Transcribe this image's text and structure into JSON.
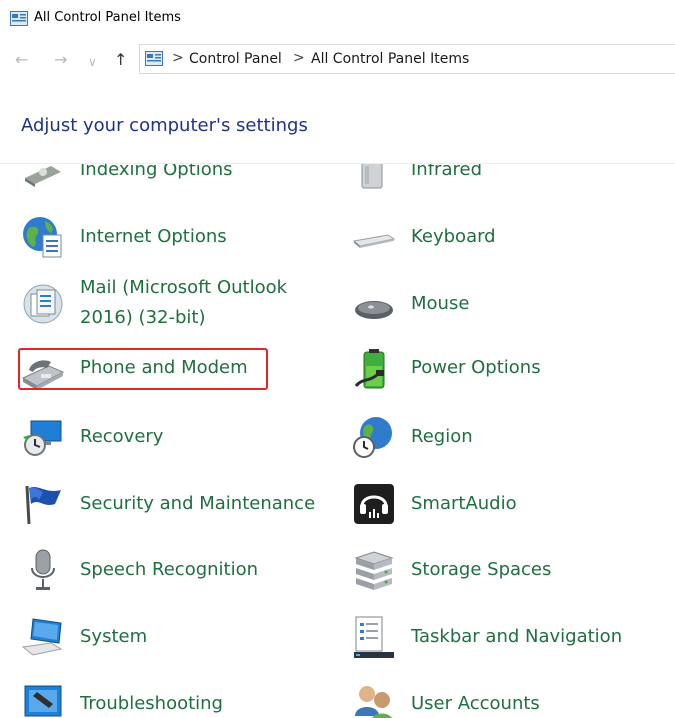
{
  "window": {
    "title": "All Control Panel Items"
  },
  "nav": {
    "back": "←",
    "forward": "→",
    "recent": "∨",
    "up": "↑"
  },
  "address": {
    "separator": ">",
    "crumbs": [
      "Control Panel",
      "All Control Panel Items"
    ]
  },
  "heading": "Adjust your computer's settings",
  "items": [
    {
      "label": "Indexing Options",
      "icon": "indexing-options-icon"
    },
    {
      "label": "Infrared",
      "icon": "infrared-icon"
    },
    {
      "label": "Internet Options",
      "icon": "internet-options-icon"
    },
    {
      "label": "Keyboard",
      "icon": "keyboard-icon"
    },
    {
      "label_line1": "Mail (Microsoft Outlook",
      "label_line2": "2016) (32-bit)",
      "icon": "mail-icon"
    },
    {
      "label": "Mouse",
      "icon": "mouse-icon"
    },
    {
      "label": "Phone and Modem",
      "icon": "phone-modem-icon",
      "highlighted": true
    },
    {
      "label": "Power Options",
      "icon": "power-options-icon"
    },
    {
      "label": "Recovery",
      "icon": "recovery-icon"
    },
    {
      "label": "Region",
      "icon": "region-icon"
    },
    {
      "label": "Security and Maintenance",
      "icon": "security-flag-icon"
    },
    {
      "label": "SmartAudio",
      "icon": "smartaudio-icon"
    },
    {
      "label": "Speech Recognition",
      "icon": "microphone-icon"
    },
    {
      "label": "Storage Spaces",
      "icon": "storage-spaces-icon"
    },
    {
      "label": "System",
      "icon": "system-icon"
    },
    {
      "label": "Taskbar and Navigation",
      "icon": "taskbar-icon"
    },
    {
      "label": "Troubleshooting",
      "icon": "troubleshooting-icon"
    },
    {
      "label": "User Accounts",
      "icon": "user-accounts-icon"
    }
  ],
  "colors": {
    "link": "#1f6f3f",
    "heading": "#1e3287",
    "highlight": "#e3262a"
  }
}
